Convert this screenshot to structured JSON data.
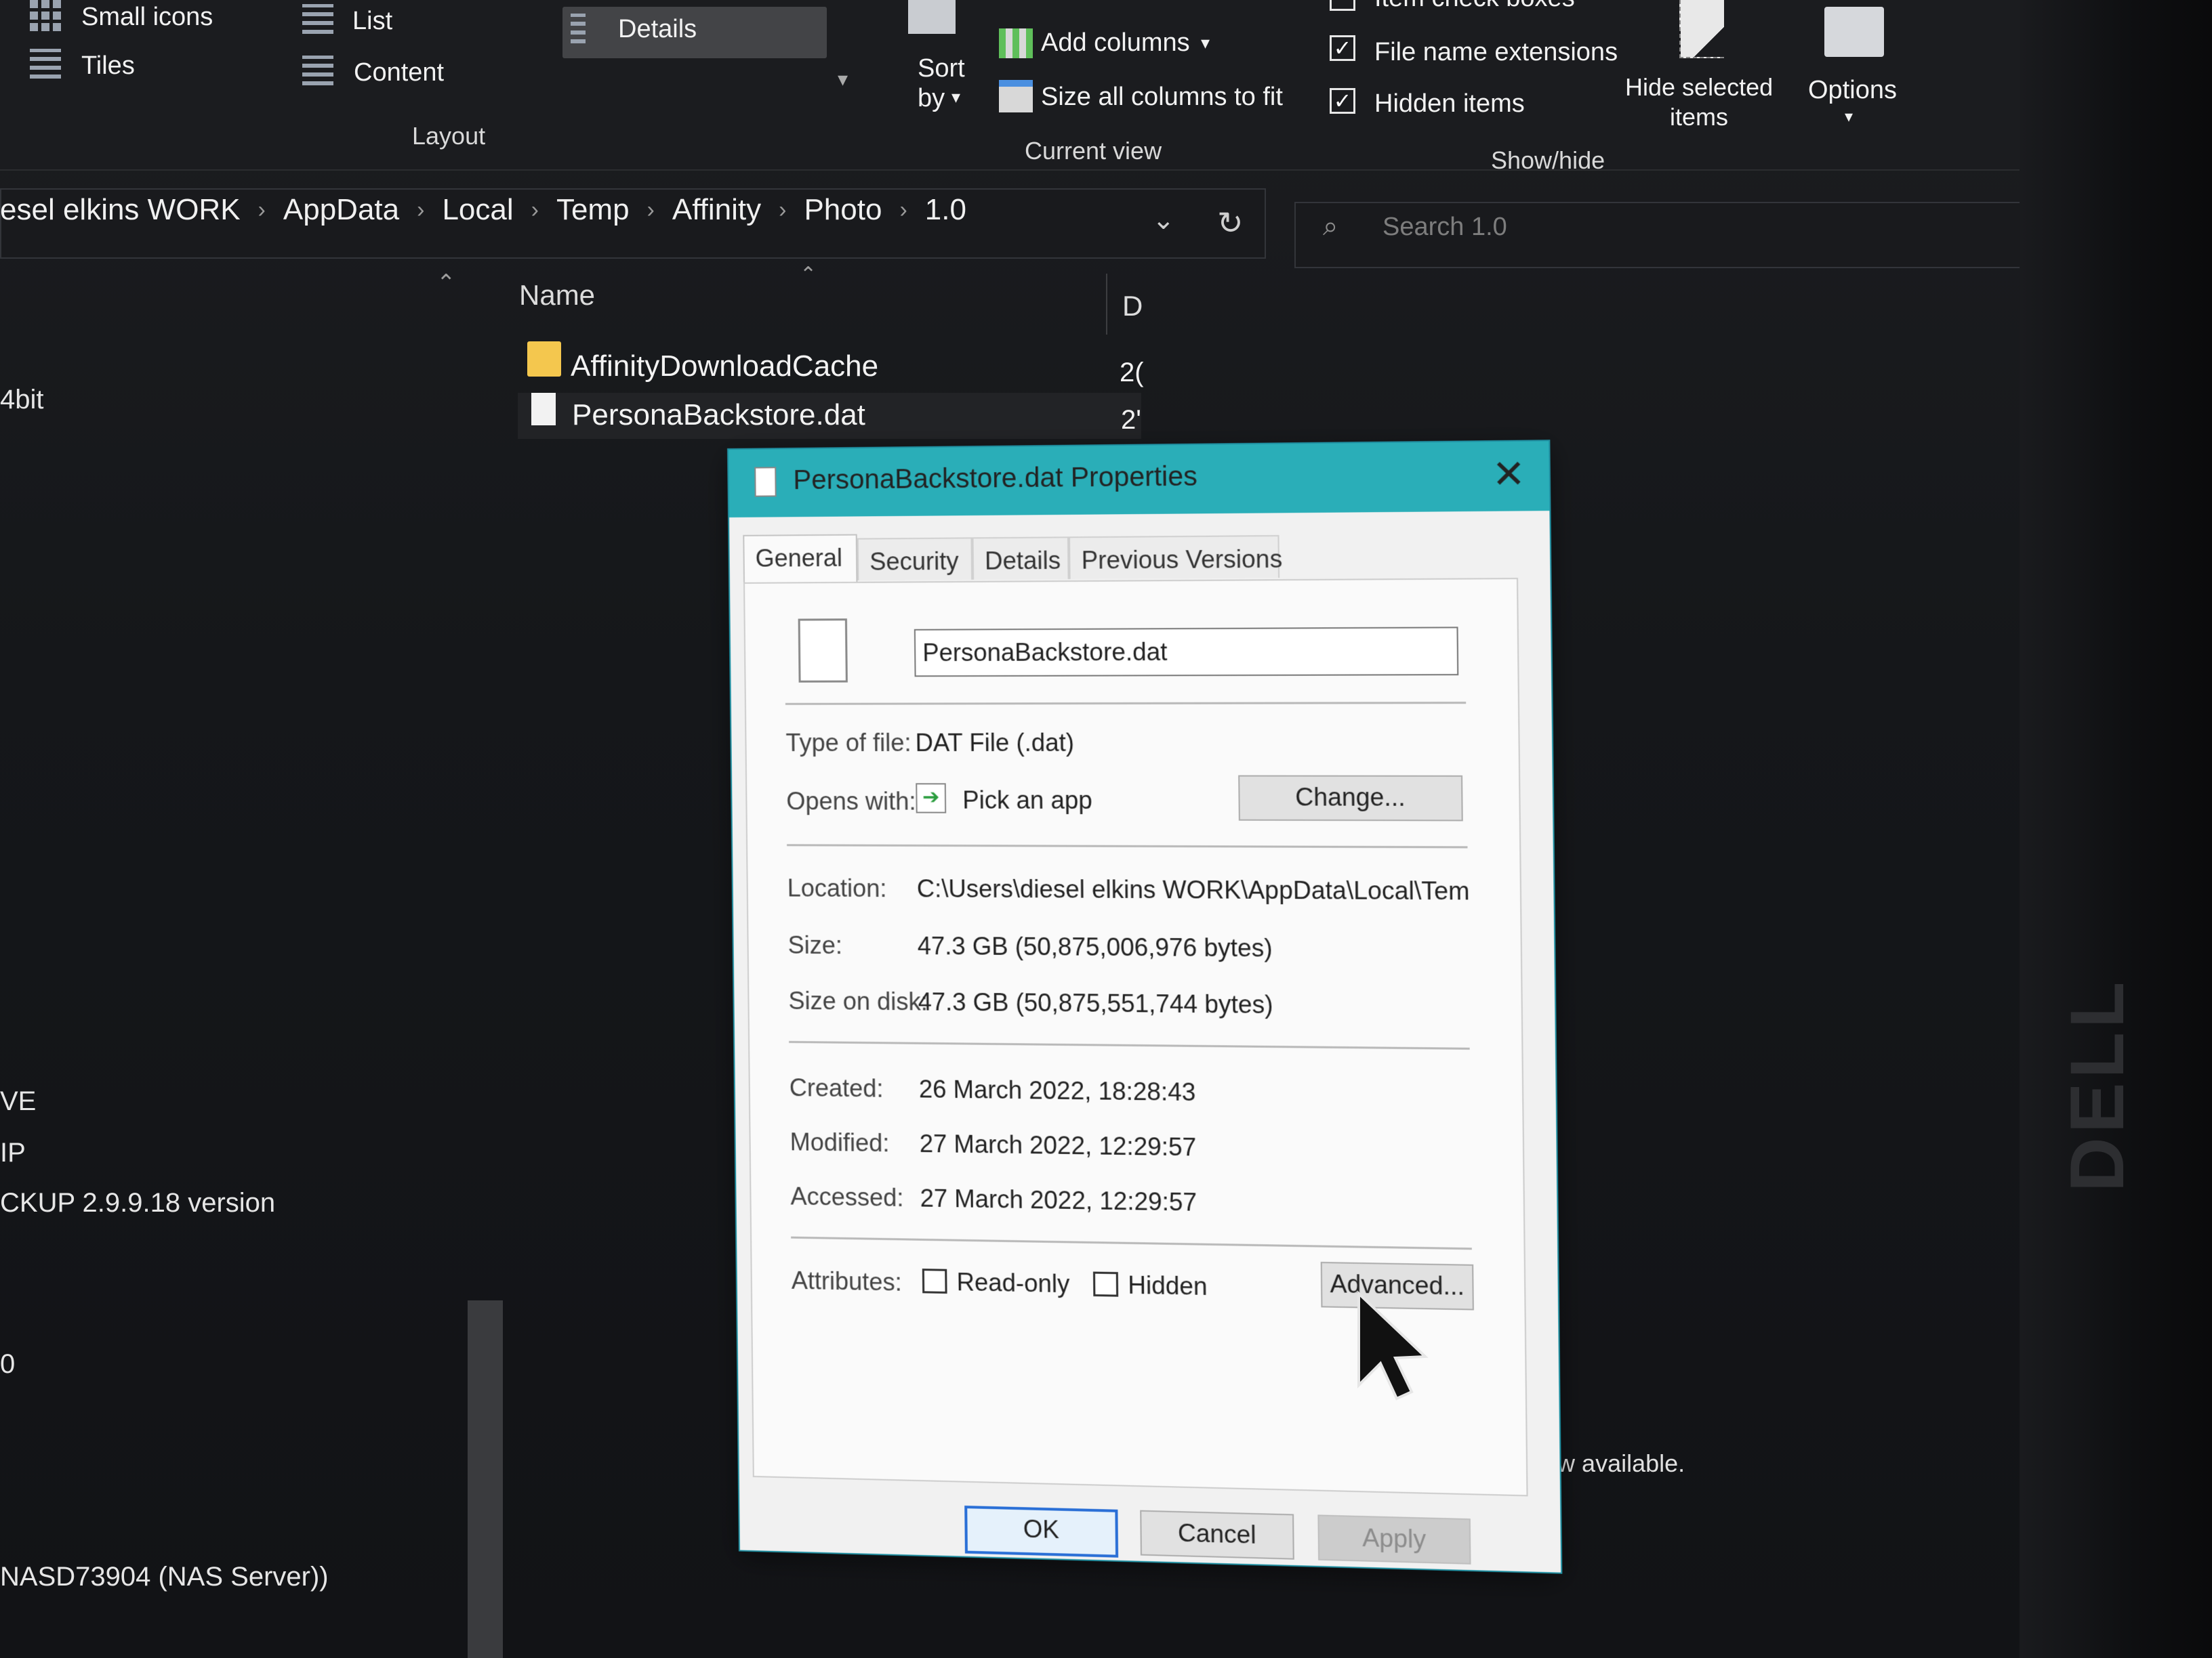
{
  "ribbon": {
    "layout": {
      "small_icons": "Small icons",
      "list": "List",
      "details": "Details",
      "tiles": "Tiles",
      "content": "Content",
      "group": "Layout"
    },
    "sort_by_line1": "Sort",
    "sort_by_line2": "by",
    "current_view": {
      "add_columns": "Add columns",
      "size_all": "Size all columns to fit",
      "group": "Current view"
    },
    "show_hide": {
      "item_check_boxes": "Item check boxes",
      "file_name_extensions": "File name extensions",
      "hidden_items": "Hidden items",
      "hide_selected_line1": "Hide selected",
      "hide_selected_line2": "items",
      "options": "Options",
      "group": "Show/hide",
      "file_name_extensions_checked": true,
      "hidden_items_checked": true
    }
  },
  "address": {
    "crumbs": [
      "esel elkins WORK",
      "AppData",
      "Local",
      "Temp",
      "Affinity",
      "Photo",
      "1.0"
    ]
  },
  "search": {
    "placeholder": "Search 1.0"
  },
  "filelist": {
    "col_name": "Name",
    "col_date": "D",
    "rows": [
      {
        "name": "AffinityDownloadCache",
        "date": "2(",
        "kind": "folder"
      },
      {
        "name": "PersonaBackstore.dat",
        "date": "2'",
        "kind": "file"
      }
    ]
  },
  "nav": {
    "items": [
      "4bit",
      "VE",
      "IP",
      "CKUP 2.9.9.18 version",
      "0",
      "NASD73904 (NAS Server))"
    ]
  },
  "preview_text": "preview available.",
  "dialog": {
    "title": "PersonaBackstore.dat Properties",
    "tabs": [
      "General",
      "Security",
      "Details",
      "Previous Versions"
    ],
    "filename": "PersonaBackstore.dat",
    "type_label": "Type of file:",
    "type_value": "DAT File (.dat)",
    "opens_label": "Opens with:",
    "opens_value": "Pick an app",
    "change_button": "Change...",
    "location_label": "Location:",
    "location_value": "C:\\Users\\diesel elkins WORK\\AppData\\Local\\Temp",
    "size_label": "Size:",
    "size_value": "47.3 GB (50,875,006,976 bytes)",
    "size_disk_label": "Size on disk:",
    "size_disk_value": "47.3 GB (50,875,551,744 bytes)",
    "created_label": "Created:",
    "created_value": "26 March 2022, 18:28:43",
    "modified_label": "Modified:",
    "modified_value": "27 March 2022, 12:29:57",
    "accessed_label": "Accessed:",
    "accessed_value": "27 March 2022, 12:29:57",
    "attributes_label": "Attributes:",
    "readonly": "Read-only",
    "hidden": "Hidden",
    "advanced_button": "Advanced...",
    "ok": "OK",
    "cancel": "Cancel",
    "apply": "Apply"
  },
  "monitor_brand": "DELL"
}
